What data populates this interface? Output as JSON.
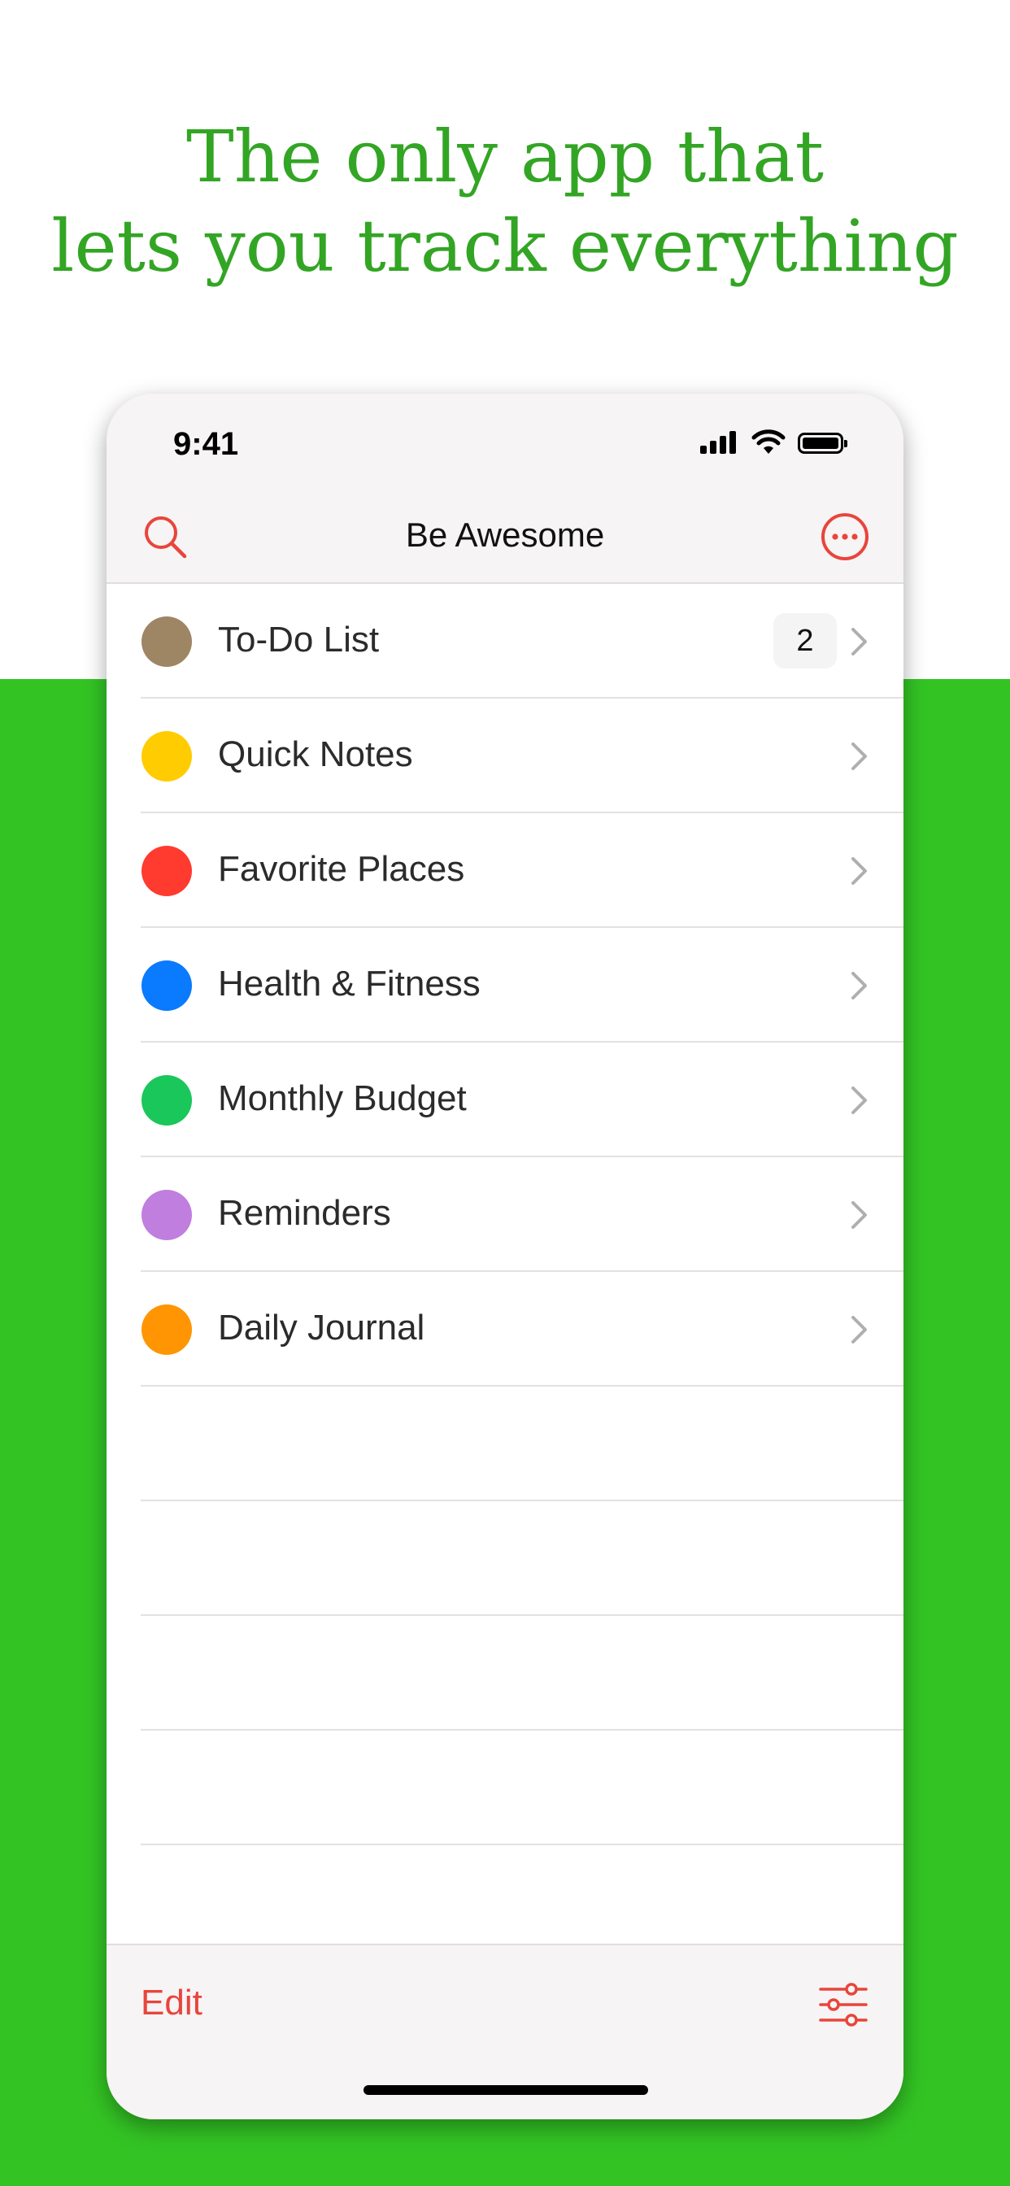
{
  "headline": {
    "line1": "The only app that",
    "line2": "lets you track everything"
  },
  "status_bar": {
    "time": "9:41",
    "icons": [
      "signal-icon",
      "wifi-icon",
      "battery-icon"
    ]
  },
  "nav": {
    "title": "Be Awesome",
    "left_icon": "search-icon",
    "right_icon": "more-options-icon"
  },
  "lists": [
    {
      "label": "To-Do List",
      "color": "#9e8564",
      "badge": "2"
    },
    {
      "label": "Quick Notes",
      "color": "#ffcc02"
    },
    {
      "label": "Favorite Places",
      "color": "#ff3b30"
    },
    {
      "label": "Health & Fitness",
      "color": "#0a7aff"
    },
    {
      "label": "Monthly Budget",
      "color": "#1ac75a"
    },
    {
      "label": "Reminders",
      "color": "#c07ede"
    },
    {
      "label": "Daily Journal",
      "color": "#ff9503"
    }
  ],
  "toolbar": {
    "edit_label": "Edit",
    "filter_icon": "sliders-icon"
  },
  "colors": {
    "accent": "#e8453c",
    "headline": "#33a524",
    "background_green": "#33c424"
  }
}
